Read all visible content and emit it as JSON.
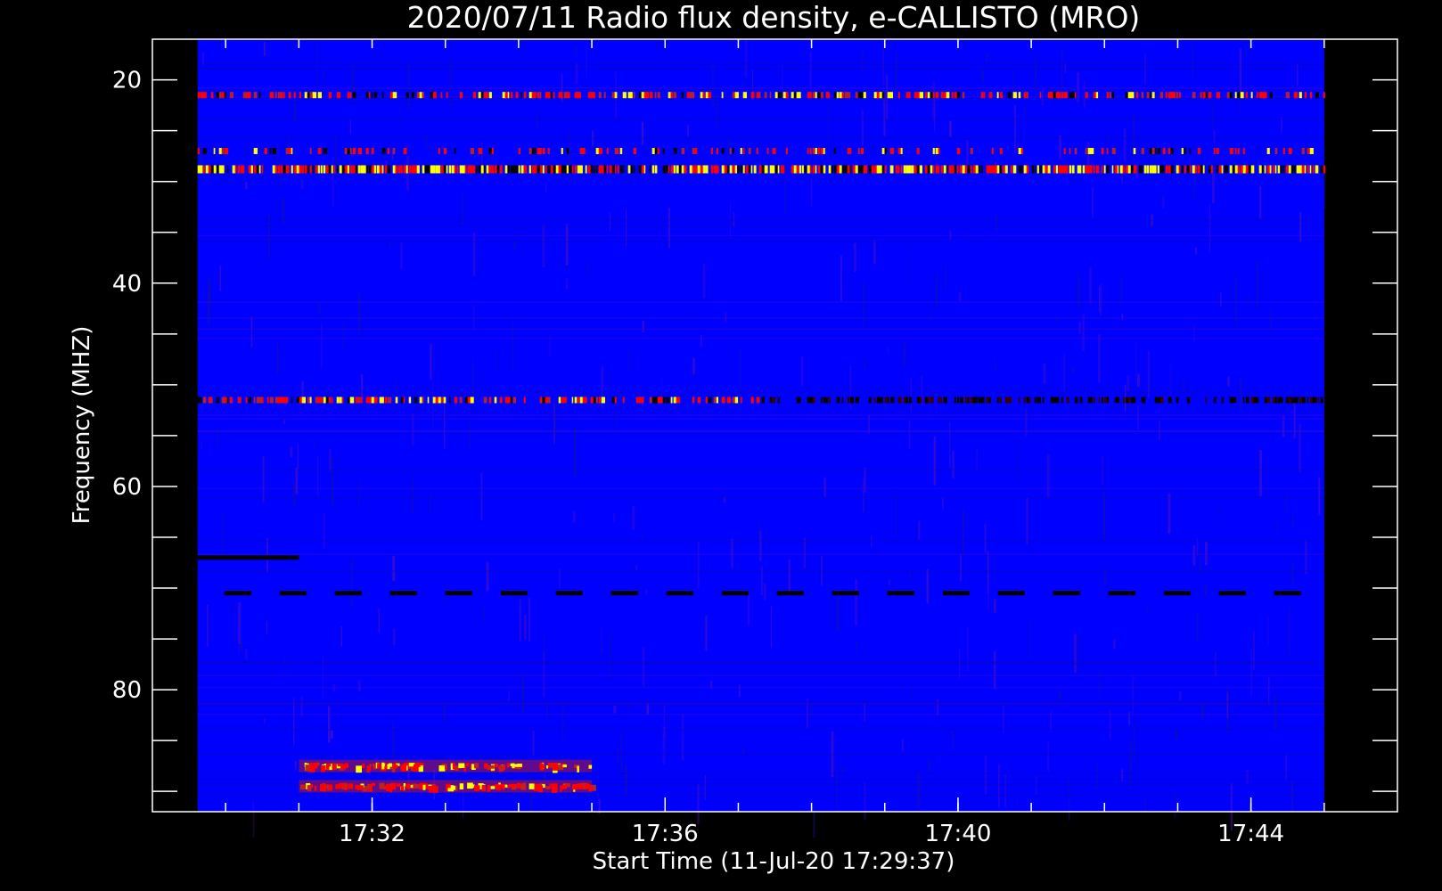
{
  "chart_data": {
    "type": "heatmap",
    "title": "2020/07/11  Radio flux density, e-CALLISTO (MRO)",
    "xlabel": "Start Time (11-Jul-20 17:29:37)",
    "ylabel": "Frequency (MHZ)",
    "x_start": "17:29:37",
    "x_end": "17:45:00",
    "xlim": [
      "17:29:00",
      "17:46:00"
    ],
    "x_ticks": [
      {
        "label": "17:32",
        "value": "17:32"
      },
      {
        "label": "17:36",
        "value": "17:36"
      },
      {
        "label": "17:40",
        "value": "17:40"
      },
      {
        "label": "17:44",
        "value": "17:44"
      }
    ],
    "ylim": [
      16,
      92
    ],
    "y_axis_reversed": true,
    "y_ticks": [
      20,
      40,
      60,
      80
    ],
    "colors": {
      "background": "#0000ff",
      "hot": "#ffff00",
      "mid": "#ff0000",
      "cold": "#000000"
    },
    "bands": [
      {
        "freq": 21.5,
        "intensity": "high",
        "pattern": "intermittent"
      },
      {
        "freq": 27.0,
        "intensity": "moderate",
        "pattern": "intermittent"
      },
      {
        "freq": 28.8,
        "intensity": "very high",
        "pattern": "continuous"
      },
      {
        "freq": 51.5,
        "intensity": "high",
        "pattern": "intermittent"
      },
      {
        "freq": 67.0,
        "intensity": "dropout",
        "pattern": "17:29:37-17:31:00"
      },
      {
        "freq": 70.5,
        "intensity": "dropout",
        "pattern": "periodic"
      },
      {
        "freq": 87.5,
        "intensity": "burst",
        "pattern": "17:31:00-17:35:00"
      },
      {
        "freq": 89.5,
        "intensity": "burst",
        "pattern": "17:31:00-17:35:00"
      }
    ]
  }
}
